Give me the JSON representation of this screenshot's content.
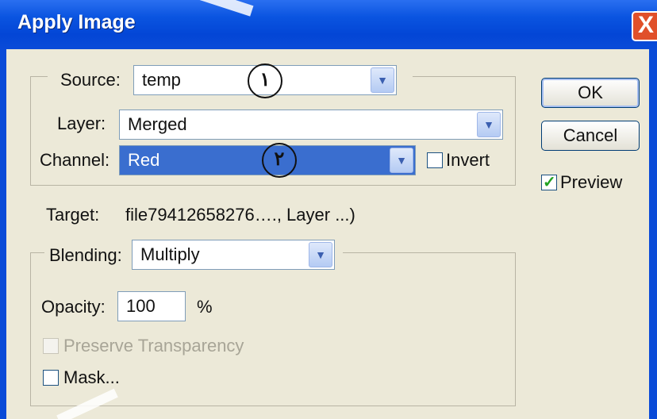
{
  "dialog": {
    "title": "Apply Image",
    "close_glyph": "X"
  },
  "source": {
    "label": "Source:",
    "file": "temp",
    "layer_label": "Layer:",
    "layer": "Merged",
    "channel_label": "Channel:",
    "channel": "Red",
    "invert_label": "Invert",
    "invert_checked": false
  },
  "target": {
    "label": "Target:",
    "value": "file79412658276…., Layer ...)"
  },
  "blending": {
    "label": "Blending:",
    "mode": "Multiply",
    "opacity_label": "Opacity:",
    "opacity_value": "100",
    "opacity_unit": "%",
    "preserve_transparency_label": "Preserve Transparency",
    "preserve_transparency_checked": false,
    "preserve_transparency_enabled": false,
    "mask_label": "Mask...",
    "mask_checked": false
  },
  "buttons": {
    "ok": "OK",
    "cancel": "Cancel",
    "preview_label": "Preview",
    "preview_checked": true
  },
  "annotations": {
    "marker_1": "١",
    "marker_2": "٢"
  },
  "colors": {
    "titlebar": "#0a54e0",
    "dialog_bg": "#ece9d8",
    "selection": "#3a6ecf",
    "close_button": "#e0502a"
  },
  "icons": [
    "dropdown-arrow-icon",
    "checkmark-icon",
    "close-icon"
  ]
}
